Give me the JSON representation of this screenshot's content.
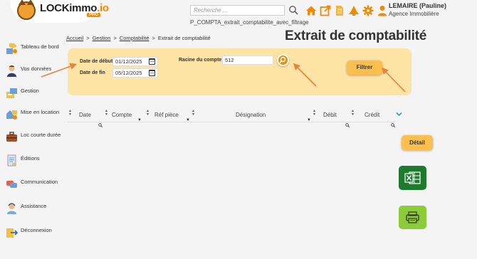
{
  "app": {
    "brand_main": "LOCKimmo",
    "brand_suffix": ".io",
    "badge": "PRO"
  },
  "search": {
    "placeholder": "Recherche ..."
  },
  "file_caption": "P_COMPTA_extrait_comptabilite_avec_filtrage",
  "user": {
    "name": "LEMAIRE (Pauline)",
    "agency": "Agence Immobilière"
  },
  "top_icons": [
    "home-icon",
    "external-link-icon",
    "document-icon",
    "alert-icon",
    "settings-gear-icon",
    "user-icon"
  ],
  "colors": {
    "accent": "#f08a00",
    "panel": "#fde3a4",
    "button": "#fbbf50",
    "excel": "#1e7a2f",
    "print": "#8ccc3a",
    "arrow": "#e8833a"
  },
  "sidebar": {
    "items": [
      {
        "label": "Tableau de bord",
        "icon": "dashboard-icon"
      },
      {
        "label": "Vos données",
        "icon": "person-icon"
      },
      {
        "label": "Gestion",
        "icon": "management-icon"
      },
      {
        "label": "Mise en location",
        "icon": "rental-icon"
      },
      {
        "label": "Loc courte durée",
        "icon": "suitcase-icon"
      },
      {
        "label": "Éditions",
        "icon": "print-doc-icon"
      },
      {
        "label": "Communication",
        "icon": "chat-icon"
      },
      {
        "label": "Assistance",
        "icon": "support-icon"
      },
      {
        "label": "Déconnexion",
        "icon": "logout-icon"
      }
    ]
  },
  "breadcrumb": {
    "items": [
      "Accueil",
      "Gestion",
      "Comptabilité"
    ],
    "current": "Extrait de comptabilité",
    "separator": ">"
  },
  "page_title": "Extrait de comptabilité",
  "filter": {
    "start_label": "Date de début",
    "start_value": "01/12/2025",
    "end_label": "Date de fin",
    "end_value": "05/12/2025",
    "account_label": "Racine du compte",
    "account_value": "512",
    "filter_button": "Filtrer"
  },
  "table": {
    "columns": [
      "Date",
      "Compte",
      "Réf pièce",
      "Désignation",
      "Débit",
      "Crédit"
    ]
  },
  "actions": {
    "detail_button": "Détail",
    "excel_icon": "excel-export-icon",
    "print_icon": "printer-icon"
  }
}
